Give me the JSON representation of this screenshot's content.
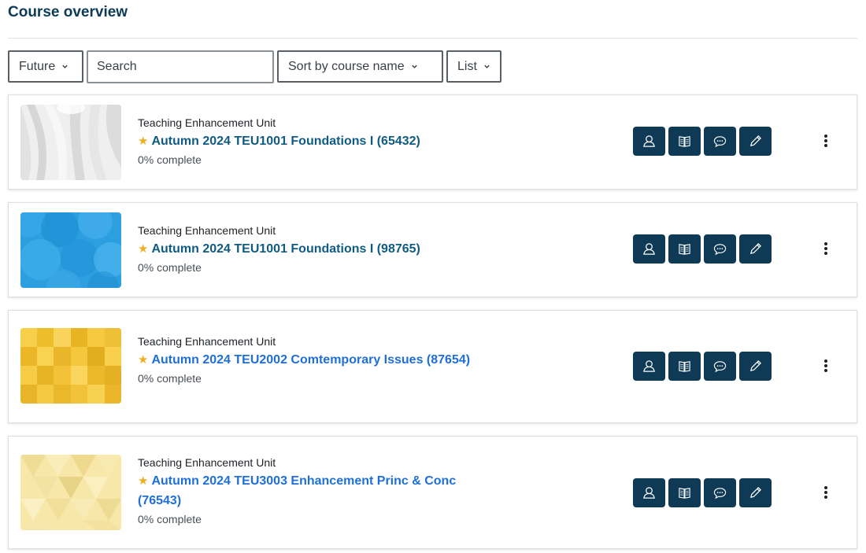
{
  "page": {
    "title": "Course overview"
  },
  "filters": {
    "grouping": "Future",
    "search_placeholder": "Search",
    "sort": "Sort by course name",
    "view": "List"
  },
  "colors": {
    "title": "#0d3b55",
    "link_dark": "#0f5b82",
    "link_bright": "#1f6fd8",
    "action_bg": "#0f3a56",
    "star": "#f0ad1e"
  },
  "action_icons": [
    "participants-icon",
    "book-icon",
    "chat-icon",
    "edit-pencil-icon"
  ],
  "courses": [
    {
      "category": "Teaching Enhancement Unit",
      "name": "Autumn 2024 TEU1001 Foundations I (65432)",
      "progress": "0% complete",
      "starred": true,
      "thumbnail": "grey-waves-pattern"
    },
    {
      "category": "Teaching Enhancement Unit",
      "name": "Autumn 2024 TEU1001 Foundations I (98765)",
      "progress": "0% complete",
      "starred": true,
      "thumbnail": "blue-circles-pattern"
    },
    {
      "category": "Teaching Enhancement Unit",
      "name": "Autumn 2024 TEU2002 Comtemporary Issues (87654)",
      "progress": "0% complete",
      "starred": true,
      "thumbnail": "yellow-squares-pattern"
    },
    {
      "category": "Teaching Enhancement Unit",
      "name": "Autumn 2024 TEU3003 Enhancement Princ & Conc (76543)",
      "progress": "0% complete",
      "starred": true,
      "thumbnail": "cream-hexagons-pattern"
    }
  ]
}
